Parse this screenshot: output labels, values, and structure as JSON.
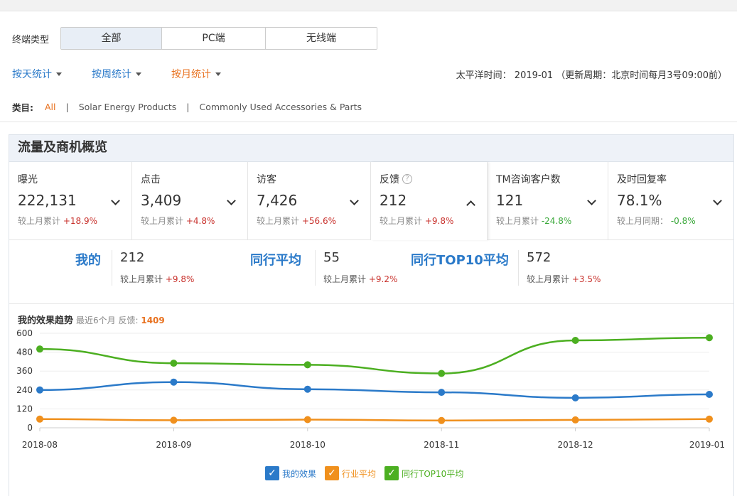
{
  "terminal": {
    "label": "终端类型",
    "options": [
      "全部",
      "PC端",
      "无线端"
    ],
    "selected": "全部"
  },
  "period": {
    "options": [
      "按天统计",
      "按周统计",
      "按月统计"
    ],
    "selected": "按月统计",
    "info": "太平洋时间： 2019-01 （更新周期：北京时间每月3号09:00前）"
  },
  "category": {
    "label": "类目:",
    "items": [
      "All",
      "Solar Energy Products",
      "Commonly Used Accessories & Parts"
    ],
    "separator": "|",
    "selected": "All"
  },
  "panel": {
    "title": "流量及商机概览"
  },
  "metrics": [
    {
      "name": "曝光",
      "value": "222,131",
      "compare_label": "较上月累计",
      "compare": "+18.9%",
      "trend": "up"
    },
    {
      "name": "点击",
      "value": "3,409",
      "compare_label": "较上月累计",
      "compare": "+4.8%",
      "trend": "up"
    },
    {
      "name": "访客",
      "value": "7,426",
      "compare_label": "较上月累计",
      "compare": "+56.6%",
      "trend": "up"
    },
    {
      "name": "反馈",
      "value": "212",
      "compare_label": "较上月累计",
      "compare": "+9.8%",
      "trend": "up",
      "help": "?"
    },
    {
      "name": "TM咨询客户数",
      "value": "121",
      "compare_label": "较上月累计",
      "compare": "-24.8%",
      "trend": "down"
    },
    {
      "name": "及时回复率",
      "value": "78.1%",
      "compare_label": "较上月同期：",
      "compare": "-0.8%",
      "trend": "down"
    }
  ],
  "compare": {
    "mine": {
      "label": "我的",
      "value": "212",
      "compare_label": "较上月累计",
      "compare": "+9.8%"
    },
    "peer_avg": {
      "label": "同行平均",
      "value": "55",
      "compare_label": "较上月累计",
      "compare": "+9.2%"
    },
    "peer_top10": {
      "label": "同行TOP10平均",
      "value": "572",
      "compare_label": "较上月累计",
      "compare": "+3.5%"
    }
  },
  "chart_title": {
    "title": "我的效果趋势",
    "sub": "最近6个月 反馈:",
    "total": "1409"
  },
  "legend": [
    {
      "label": "我的效果",
      "color": "#2b7ac9",
      "check": "✓"
    },
    {
      "label": "行业平均",
      "color": "#f0901d",
      "check": "✓"
    },
    {
      "label": "同行TOP10平均",
      "color": "#4caf21",
      "check": "✓"
    }
  ],
  "chart_data": {
    "type": "line",
    "x": [
      "2018-08",
      "2018-09",
      "2018-10",
      "2018-11",
      "2018-12",
      "2019-01"
    ],
    "ylim": [
      0,
      600
    ],
    "yticks": [
      0,
      120,
      240,
      360,
      480,
      600
    ],
    "grid": true,
    "legend_position": "bottom",
    "series": [
      {
        "name": "我的效果",
        "color": "#2b7ac9",
        "values": [
          240,
          290,
          245,
          225,
          190,
          212
        ]
      },
      {
        "name": "行业平均",
        "color": "#f0901d",
        "values": [
          55,
          48,
          52,
          46,
          50,
          55
        ]
      },
      {
        "name": "同行TOP10平均",
        "color": "#4caf21",
        "values": [
          500,
          410,
          400,
          345,
          555,
          572
        ]
      }
    ]
  }
}
